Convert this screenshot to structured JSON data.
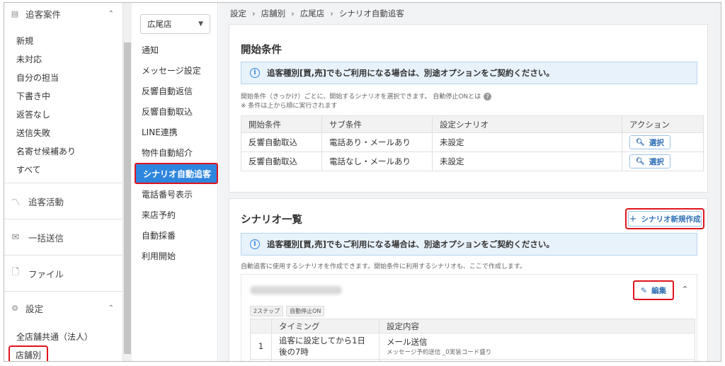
{
  "nav": {
    "section1": {
      "label": "追客案件",
      "chevron": "⌃"
    },
    "items": [
      "新規",
      "未対応",
      "自分の担当",
      "下書き中",
      "返答なし",
      "送信失敗",
      "名寄せ候補あり",
      "すべて"
    ],
    "big_items": [
      "追客活動",
      "一括送信",
      "ファイル"
    ],
    "settings": {
      "label": "設定",
      "chevron": "⌃"
    },
    "settings_items": [
      "全店舗共通（法人）",
      "店舗別"
    ]
  },
  "sub": {
    "store": "広尾店",
    "items": [
      "通知",
      "メッセージ設定",
      "反響自動返信",
      "反響自動取込",
      "LINE連携",
      "物件自動紹介",
      "シナリオ自動追客",
      "電話番号表示",
      "来店予約",
      "自動採番",
      "利用開始"
    ]
  },
  "breadcrumb": [
    "設定",
    "店舗別",
    "広尾店",
    "シナリオ自動追客"
  ],
  "start": {
    "title": "開始条件",
    "info": "追客種別[買,売]でもご利用になる場合は、別途オプションをご契約ください。",
    "note1": "開始条件（きっかけ）ごとに、開始するシナリオを選択できます。 自動停止ONとは",
    "note2": "※ 条件は上から順に実行されます",
    "headers": [
      "開始条件",
      "サブ条件",
      "設定シナリオ",
      "アクション"
    ],
    "rows": [
      {
        "cond": "反響自動取込",
        "sub": "電話あり・メールあり",
        "scenario": "未設定",
        "action": "選択"
      },
      {
        "cond": "反響自動取込",
        "sub": "電話なし・メールあり",
        "scenario": "未設定",
        "action": "選択"
      }
    ]
  },
  "list": {
    "title": "シナリオ一覧",
    "new_button": "シナリオ新規作成",
    "info": "追客種別[買,売]でもご利用になる場合は、別途オプションをご契約ください。",
    "note": "自動追客に使用するシナリオを作成できます。開始条件に利用するシナリオも、ここで作成します。",
    "edit": "編集",
    "tags": [
      "2ステップ",
      "自動停止ON"
    ],
    "headers": [
      "",
      "タイミング",
      "設定内容"
    ],
    "steps": [
      {
        "no": "1",
        "timing": "追客に設定してから1日後の7時",
        "content": "メール送信",
        "detail": "メッセージ予約送信 _0実装コード盛り"
      }
    ]
  }
}
